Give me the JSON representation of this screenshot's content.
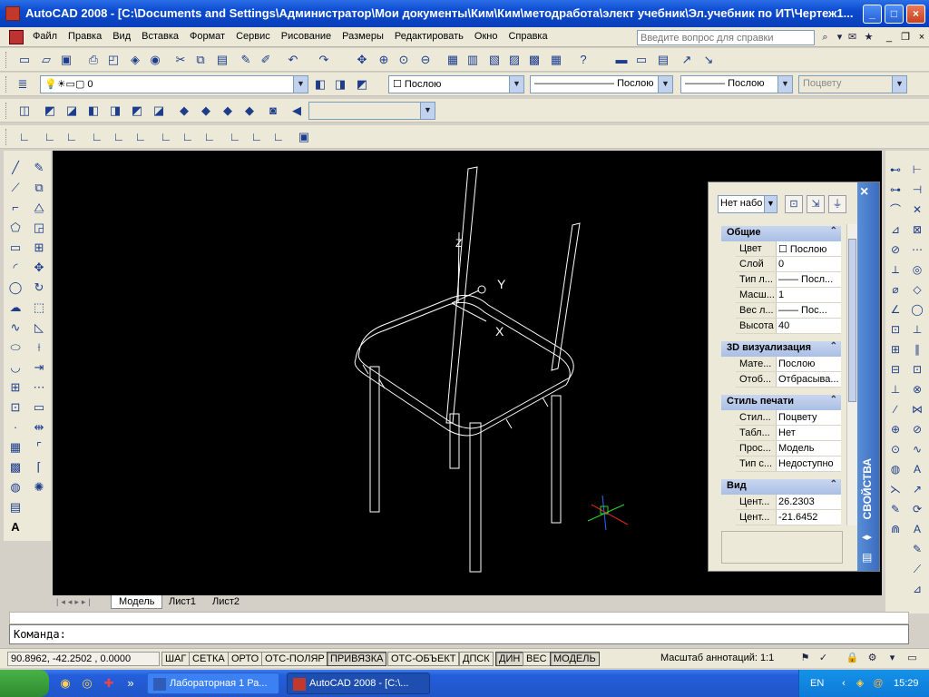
{
  "window": {
    "title": "AutoCAD 2008 - [C:\\Documents and Settings\\Администратор\\Мои документы\\Ким\\Ким\\методработа\\элект учебник\\Эл.учебник по ИТ\\Чертеж1..."
  },
  "menu": {
    "items": [
      "Файл",
      "Правка",
      "Вид",
      "Вставка",
      "Формат",
      "Сервис",
      "Рисование",
      "Размеры",
      "Редактировать",
      "Окно",
      "Справка"
    ],
    "help_placeholder": "Введите вопрос для справки"
  },
  "layers_toolbar": {
    "layer_value": "0",
    "color_value": "Послою",
    "linetype_value": "Послою",
    "lineweight_value": "Послою",
    "plotstyle_value": "Поцвету"
  },
  "properties": {
    "title": "СВОЙСТВА",
    "selection": "Нет набо",
    "sections": [
      {
        "name": "Общие",
        "rows": [
          {
            "key": "Цвет",
            "value": "Послою"
          },
          {
            "key": "Слой",
            "value": "0"
          },
          {
            "key": "Тип л...",
            "value": "—— Посл..."
          },
          {
            "key": "Масш...",
            "value": "1"
          },
          {
            "key": "Вес л...",
            "value": "—— Пос..."
          },
          {
            "key": "Высота",
            "value": "40"
          }
        ]
      },
      {
        "name": "3D визуализация",
        "rows": [
          {
            "key": "Мате...",
            "value": "Послою"
          },
          {
            "key": "Отоб...",
            "value": "Отбрасыва..."
          }
        ]
      },
      {
        "name": "Стиль печати",
        "rows": [
          {
            "key": "Стил...",
            "value": "Поцвету"
          },
          {
            "key": "Табл...",
            "value": "Нет"
          },
          {
            "key": "Прос...",
            "value": "Модель"
          },
          {
            "key": "Тип с...",
            "value": "Недоступно"
          }
        ]
      },
      {
        "name": "Вид",
        "rows": [
          {
            "key": "Цент...",
            "value": "26.2303"
          },
          {
            "key": "Цент...",
            "value": "-21.6452"
          }
        ]
      }
    ]
  },
  "ucs": {
    "x_label": "X",
    "y_label": "Y",
    "z_label": "Z"
  },
  "layout_tabs": [
    "Модель",
    "Лист1",
    "Лист2"
  ],
  "command": {
    "prompt": "Команда:"
  },
  "status": {
    "coords": "90.8962, -42.2502 , 0.0000",
    "buttons": [
      {
        "label": "ШАГ",
        "on": false
      },
      {
        "label": "СЕТКА",
        "on": false
      },
      {
        "label": "ОРТО",
        "on": false
      },
      {
        "label": "ОТС-ПОЛЯР",
        "on": false
      },
      {
        "label": "ПРИВЯЗКА",
        "on": true
      },
      {
        "label": "ОТС-ОБЪЕКТ",
        "on": false
      },
      {
        "label": "ДПСК",
        "on": false
      },
      {
        "label": "ДИН",
        "on": true
      },
      {
        "label": "ВЕС",
        "on": false
      },
      {
        "label": "МОДЕЛЬ",
        "on": true
      }
    ],
    "annotation_scale": "Масштаб аннотаций:  1:1"
  },
  "taskbar": {
    "tasks": [
      {
        "label": "Лабораторная 1  Ра...",
        "active": false
      },
      {
        "label": "AutoCAD 2008 - [C:\\...",
        "active": true
      }
    ],
    "language": "EN",
    "clock": "15:29"
  },
  "colors": {
    "titlebar": "#0b4ad0",
    "drawing_bg": "#000000",
    "model_lines": "#ffffff",
    "props_bar": "#3a6cc0"
  }
}
